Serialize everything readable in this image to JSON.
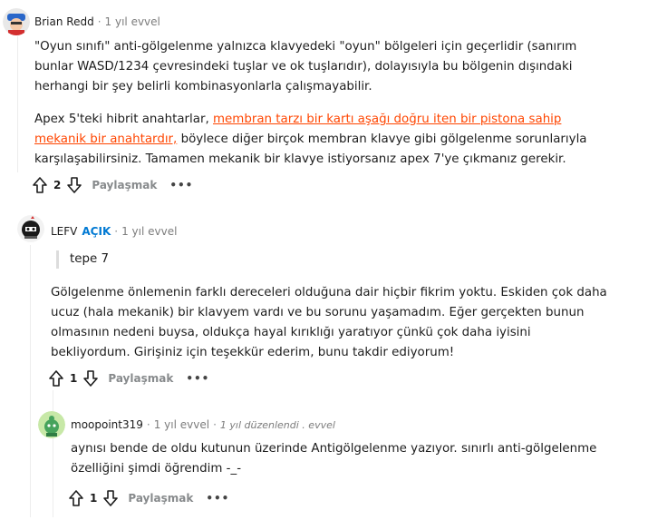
{
  "comments": [
    {
      "author": "Brian Redd",
      "time": "1 yıl evvel",
      "paragraphs": [
        "\"Oyun sınıfı\" anti-gölgelenme yalnızca klavyedeki \"oyun\" bölgeleri için geçerlidir (sanırım bunlar WASD/1234 çevresindeki tuşlar ve ok tuşlarıdır), dolayısıyla bu bölgenin dışındaki herhangi bir şey belirli kombinasyonlarla çalışmayabilir."
      ],
      "p2_before": "Apex 5'teki hibrit anahtarlar, ",
      "p2_link": "membran tarzı bir kartı aşağı doğru iten bir pistona sahip mekanik bir anahtardır,",
      "p2_after": " böylece diğer birçok membran klavye gibi gölgelenme sorunlarıyla karşılaşabilirsiniz. Tamamen mekanik bir klavye istiyorsanız apex 7'ye çıkmanız gerekir.",
      "votes": "2",
      "share_label": "Paylaşmak",
      "more_label": "•••"
    },
    {
      "author": "LEFV",
      "op_badge": "AÇIK",
      "time": "1 yıl evvel",
      "quote": "tepe 7",
      "paragraph": "Gölgelenme önlemenin farklı dereceleri olduğuna dair hiçbir fikrim yoktu. Eskiden çok daha ucuz (hala mekanik) bir klavyem vardı ve bu sorunu yaşamadım. Eğer gerçekten bunun olmasının nedeni buysa, oldukça hayal kırıklığı yaratıyor çünkü çok daha iyisini bekliyordum. Girişiniz için teşekkür ederim, bunu takdir ediyorum!",
      "votes": "1",
      "share_label": "Paylaşmak",
      "more_label": "•••"
    },
    {
      "author": "moopoint319",
      "time": "1 yıl evvel",
      "edited": "1 yıl düzenlendi . evvel",
      "paragraph": "aynısı bende de oldu kutunun üzerinde Antigölgelenme yazıyor. sınırlı anti-gölgelenme özelliğini şimdi öğrendim -_-",
      "votes": "1",
      "share_label": "Paylaşmak",
      "more_label": "•••"
    }
  ],
  "colors": {
    "link": "#ff4500",
    "op": "#0079d3",
    "meta": "#7c7c7c"
  },
  "icons": [
    "upvote-icon",
    "downvote-icon",
    "more-icon"
  ]
}
